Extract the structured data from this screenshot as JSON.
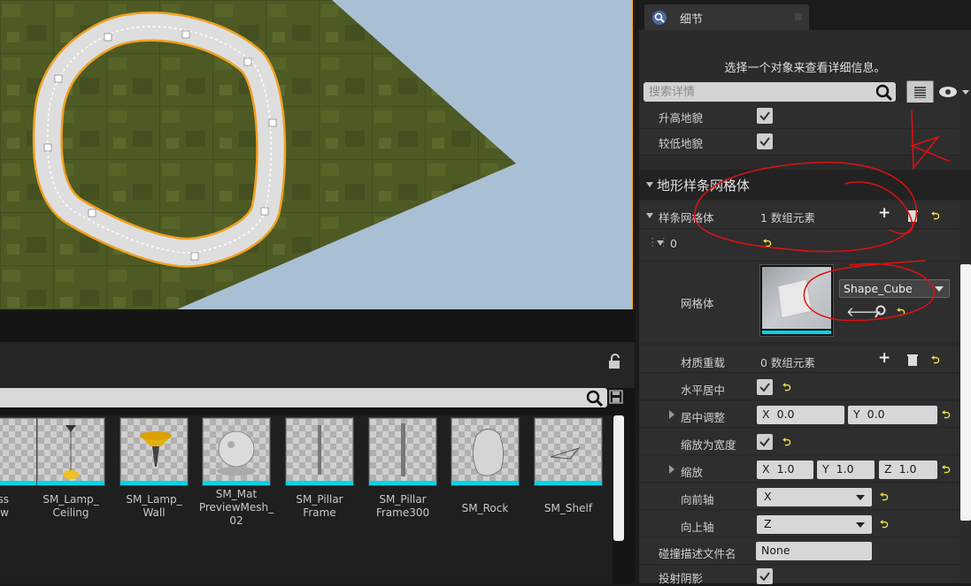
{
  "viewport": {
    "label": "level viewport"
  },
  "content_browser": {
    "assets": [
      {
        "label": "ss\nw"
      },
      {
        "label": "SM_Lamp_\nCeiling"
      },
      {
        "label": "SM_Lamp_\nWall"
      },
      {
        "label": "SM_Mat\nPreviewMesh_\n02"
      },
      {
        "label": "SM_Pillar\nFrame"
      },
      {
        "label": "SM_Pillar\nFrame300"
      },
      {
        "label": "SM_Rock"
      },
      {
        "label": "SM_Shelf"
      }
    ]
  },
  "details": {
    "tab_label": "细节",
    "message": "选择一个对象来查看详细信息。",
    "search_placeholder": "搜索详情",
    "rows": {
      "raise_terrain": "升高地貌",
      "lower_terrain": "较低地貌",
      "section_title": "地形样条网格体",
      "spline_meshes": "样条网格体",
      "spline_meshes_count": "1 数组元素",
      "index_0": "0",
      "mesh": "网格体",
      "mesh_value": "Shape_Cube",
      "material_overrides": "材质重载",
      "material_overrides_count": "0 数组元素",
      "center_h": "水平居中",
      "center_adjust": "居中调整",
      "center_adjust_x": "0.0",
      "center_adjust_y": "0.0",
      "scale_to_width": "缩放为宽度",
      "scale": "缩放",
      "scale_x": "1.0",
      "scale_y": "1.0",
      "scale_z": "1.0",
      "forward_axis": "向前轴",
      "forward_axis_value": "X",
      "up_axis": "向上轴",
      "up_axis_value": "Z",
      "collision_profile": "碰撞描述文件名",
      "collision_profile_value": "None",
      "cast_shadow": "投射阴影"
    },
    "axis_labels": {
      "x": "X",
      "y": "Y",
      "z": "Z"
    }
  },
  "colors": {
    "accent_cyan": "#00d4e8",
    "selection_orange": "#ffb000",
    "annotation_red": "#e01010"
  }
}
